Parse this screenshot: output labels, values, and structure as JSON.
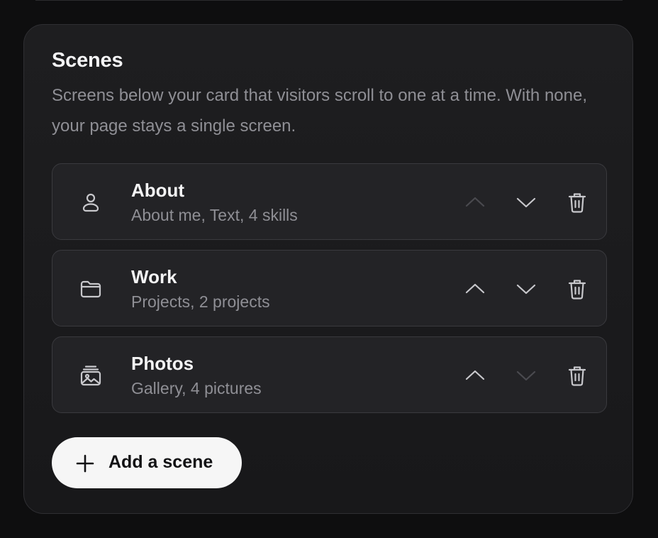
{
  "section": {
    "title": "Scenes",
    "description": "Screens below your card that visitors scroll to one at a time. With none, your page stays a single screen."
  },
  "scenes": [
    {
      "name": "About",
      "summary": "About me, Text, 4 skills",
      "icon": "person-icon",
      "move_up_enabled": false,
      "move_down_enabled": true
    },
    {
      "name": "Work",
      "summary": "Projects, 2 projects",
      "icon": "folder-icon",
      "move_up_enabled": true,
      "move_down_enabled": true
    },
    {
      "name": "Photos",
      "summary": "Gallery, 4 pictures",
      "icon": "gallery-icon",
      "move_up_enabled": true,
      "move_down_enabled": false
    }
  ],
  "add_button": {
    "label": "Add a scene",
    "icon": "plus-icon"
  },
  "colors": {
    "page_background": "#0e0e0f",
    "panel_background": "#1e1e20",
    "row_background": "#232326",
    "text_primary": "#f4f4f5",
    "text_secondary": "#8f8f95",
    "control_enabled": "#c8c8cc",
    "control_disabled": "#4a4a4f",
    "button_background": "#f6f6f6"
  }
}
